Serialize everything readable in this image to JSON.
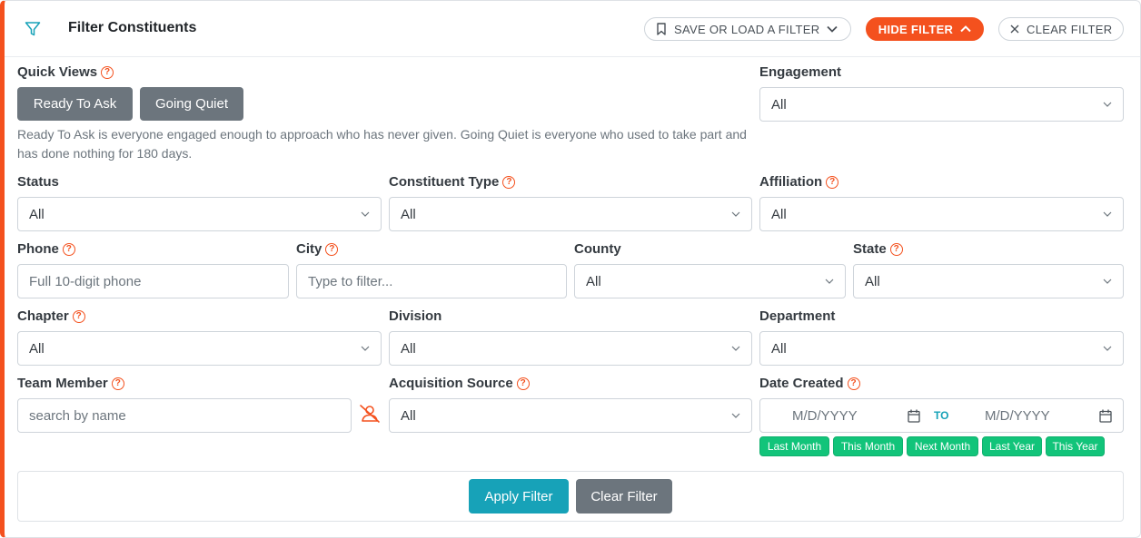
{
  "header": {
    "title": "Filter Constituents",
    "save_load_label": "SAVE OR LOAD A FILTER",
    "hide_filter_label": "HIDE FILTER",
    "clear_filter_label": "CLEAR FILTER"
  },
  "quick_views": {
    "label": "Quick Views",
    "buttons": [
      "Ready To Ask",
      "Going Quiet"
    ],
    "description": "Ready To Ask is everyone engaged enough to approach who has never given. Going Quiet is everyone who used to take part and has done nothing for 180 days."
  },
  "fields": {
    "engagement": {
      "label": "Engagement",
      "value": "All"
    },
    "status": {
      "label": "Status",
      "value": "All"
    },
    "constituent_type": {
      "label": "Constituent Type",
      "value": "All"
    },
    "affiliation": {
      "label": "Affiliation",
      "value": "All"
    },
    "phone": {
      "label": "Phone",
      "placeholder": "Full 10-digit phone"
    },
    "city": {
      "label": "City",
      "placeholder": "Type to filter..."
    },
    "county": {
      "label": "County",
      "value": "All"
    },
    "state": {
      "label": "State",
      "value": "All"
    },
    "chapter": {
      "label": "Chapter",
      "value": "All"
    },
    "division": {
      "label": "Division",
      "value": "All"
    },
    "department": {
      "label": "Department",
      "value": "All"
    },
    "team_member": {
      "label": "Team Member",
      "placeholder": "search by name"
    },
    "acquisition_source": {
      "label": "Acquisition Source",
      "value": "All"
    },
    "date_created": {
      "label": "Date Created",
      "from_placeholder": "M/D/YYYY",
      "to_label": "TO",
      "to_placeholder": "M/D/YYYY",
      "shortcuts": [
        "Last Month",
        "This Month",
        "Next Month",
        "Last Year",
        "This Year"
      ]
    }
  },
  "footer": {
    "apply_label": "Apply Filter",
    "clear_label": "Clear Filter"
  },
  "colors": {
    "accent": "#f4511e",
    "primary": "#17a2b8",
    "secondary": "#6c757d",
    "chip": "#12c47a"
  }
}
